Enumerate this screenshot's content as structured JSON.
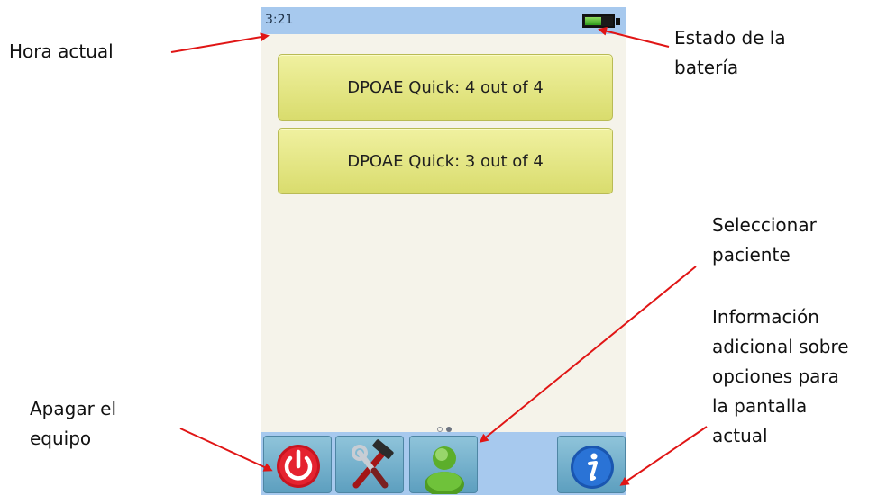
{
  "status_bar": {
    "time": "3:21",
    "battery_level": 0.55
  },
  "tests": [
    {
      "label": "DPOAE Quick: 4 out of 4"
    },
    {
      "label": "DPOAE Quick: 3 out of 4"
    }
  ],
  "pager": {
    "pages": 2,
    "current": 2
  },
  "toolbar": {
    "buttons": [
      {
        "icon": "power-icon"
      },
      {
        "icon": "tools-icon"
      },
      {
        "icon": "patient-icon"
      },
      {
        "icon": "info-icon"
      }
    ]
  },
  "annotations": {
    "hora_actual": "Hora actual",
    "estado_bateria_l1": "Estado de la",
    "estado_bateria_l2": "batería",
    "seleccionar_l1": "Seleccionar",
    "seleccionar_l2": "paciente",
    "info_l1": "Información",
    "info_l2": "adicional sobre",
    "info_l3": "opciones para",
    "info_l4": "la pantalla",
    "info_l5": "actual",
    "apagar_l1": "Apagar el",
    "apagar_l2": "equipo"
  },
  "colors": {
    "status_bar": "#a7c9ee",
    "test_button": "#e6e88a",
    "toolbar_button": "#79b3cf",
    "arrow": "#e01515",
    "power_red": "#d0121d",
    "patient_green": "#5fae2a",
    "info_blue": "#1e5fb8"
  }
}
